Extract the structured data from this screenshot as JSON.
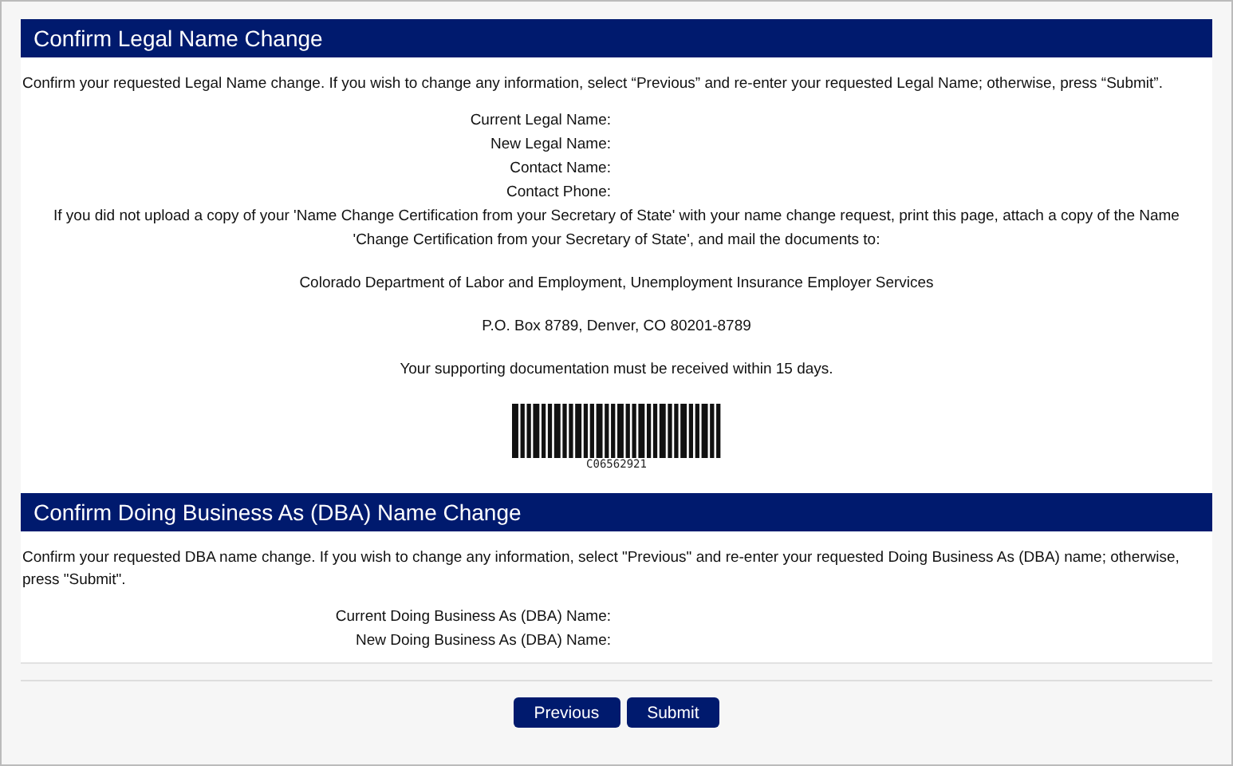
{
  "sections": [
    {
      "title": "Confirm Legal Name Change",
      "intro": "Confirm your requested Legal Name change. If you wish to change any information, select “Previous” and re-enter your requested Legal Name; otherwise, press “Submit”.",
      "fields": [
        "Current Legal Name:",
        "New Legal Name:",
        "Contact Name:",
        "Contact Phone:"
      ],
      "notes": [
        "If you did not upload a copy of your 'Name Change Certification from your Secretary of State' with your name change request, print this page, attach a copy of the Name 'Change Certification from your Secretary of State', and mail the documents to:",
        "Colorado Department of Labor and Employment, Unemployment Insurance Employer Services",
        "P.O. Box 8789, Denver, CO 80201-8789",
        "Your supporting documentation must be received within 15 days."
      ],
      "barcode": "C06562921"
    },
    {
      "title": "Confirm Doing Business As (DBA) Name Change",
      "intro": "Confirm your requested DBA name change. If you wish to change any information, select \"Previous\" and re-enter your requested Doing Business As (DBA) name; otherwise, press \"Submit\".",
      "fields": [
        "Current Doing Business As (DBA) Name:",
        "New Doing Business As (DBA) Name:"
      ]
    }
  ],
  "buttons": [
    "Previous",
    "Submit"
  ]
}
